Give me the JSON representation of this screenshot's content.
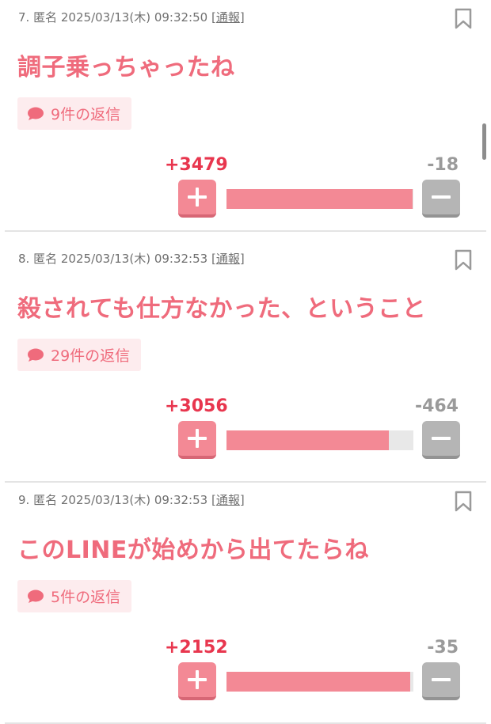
{
  "accent_color": "#ef6b7c",
  "plus_color": "#e8364e",
  "minus_color": "#9a9a9a",
  "comments": [
    {
      "number": "7.",
      "author": "匿名",
      "datetime": "2025/03/13(木) 09:32:50",
      "report_open": "[",
      "report_label": "通報",
      "report_close": "]",
      "text": "調子乗っちゃったね",
      "reply_label": "9件の返信",
      "plus": "+3479",
      "minus": "-18",
      "plus_ratio": 0.995
    },
    {
      "number": "8.",
      "author": "匿名",
      "datetime": "2025/03/13(木) 09:32:53",
      "report_open": "[",
      "report_label": "通報",
      "report_close": "]",
      "text": "殺されても仕方なかった、ということ",
      "reply_label": "29件の返信",
      "plus": "+3056",
      "minus": "-464",
      "plus_ratio": 0.868
    },
    {
      "number": "9.",
      "author": "匿名",
      "datetime": "2025/03/13(木) 09:32:53",
      "report_open": "[",
      "report_label": "通報",
      "report_close": "]",
      "text": "このLINEが始めから出てたらね",
      "reply_label": "5件の返信",
      "plus": "+2152",
      "minus": "-35",
      "plus_ratio": 0.984
    }
  ]
}
